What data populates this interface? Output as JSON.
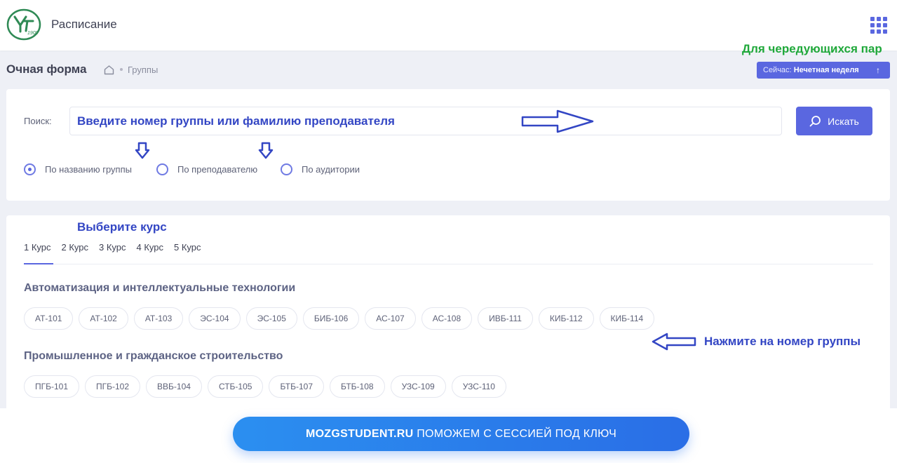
{
  "header": {
    "app_title": "Расписание",
    "logo_text": "1909"
  },
  "alt_note": "Для чередующихся пар",
  "subheader": {
    "title": "Очная форма",
    "breadcrumb": "Группы"
  },
  "week_badge": {
    "label": "Сейчас:",
    "value": "Нечетная неделя",
    "arrow": "↑"
  },
  "search": {
    "label": "Поиск:",
    "placeholder": "Введите номер группы или фамилию преподавателя",
    "button_label": "Искать",
    "options": [
      {
        "label": "По названию группы",
        "checked": true
      },
      {
        "label": "По преподавателю",
        "checked": false
      },
      {
        "label": "По аудитории",
        "checked": false
      }
    ]
  },
  "annotations": {
    "choose_course": "Выберите курс",
    "click_group": "Нажмите на номер группы"
  },
  "courses": {
    "tabs": [
      "1 Курс",
      "2 Курс",
      "3 Курс",
      "4 Курс",
      "5 Курс"
    ],
    "active": "1 Курс"
  },
  "sections": [
    {
      "title": "Автоматизация и интеллектуальные технологии",
      "groups": [
        "АТ-101",
        "АТ-102",
        "АТ-103",
        "ЭС-104",
        "ЭС-105",
        "БИБ-106",
        "АС-107",
        "АС-108",
        "ИВБ-111",
        "КИБ-112",
        "КИБ-114"
      ]
    },
    {
      "title": "Промышленное и гражданское строительство",
      "groups": [
        "ПГБ-101",
        "ПГБ-102",
        "ВВБ-104",
        "СТБ-105",
        "БТБ-107",
        "БТБ-108",
        "УЗС-109",
        "УЗС-110"
      ]
    }
  ],
  "promo": {
    "brand": "MOZGSTUDENT.RU",
    "text": "ПОМОЖЕМ С СЕССИЕЙ ПОД КЛЮЧ"
  },
  "colors": {
    "accent": "#5a67e0",
    "annotation": "#3346c4",
    "note_green": "#1fa83a",
    "logo_green": "#2f8a55"
  }
}
